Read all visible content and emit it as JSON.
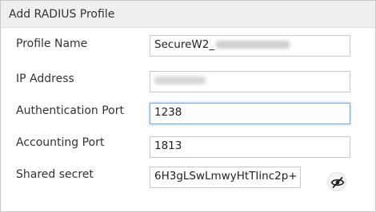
{
  "dialog": {
    "title": "Add RADIUS Profile"
  },
  "form": {
    "profile_name": {
      "label": "Profile Name",
      "value": "SecureW2_"
    },
    "ip_address": {
      "label": "IP Address",
      "value": ""
    },
    "authentication_port": {
      "label": "Authentication Port",
      "value": "1238"
    },
    "accounting_port": {
      "label": "Accounting Port",
      "value": "1813"
    },
    "shared_secret": {
      "label": "Shared secret",
      "value": "6H3gLSwLmwyHtTIinc2p+"
    }
  },
  "icons": {
    "toggle_visibility": "eye-slash-icon"
  }
}
